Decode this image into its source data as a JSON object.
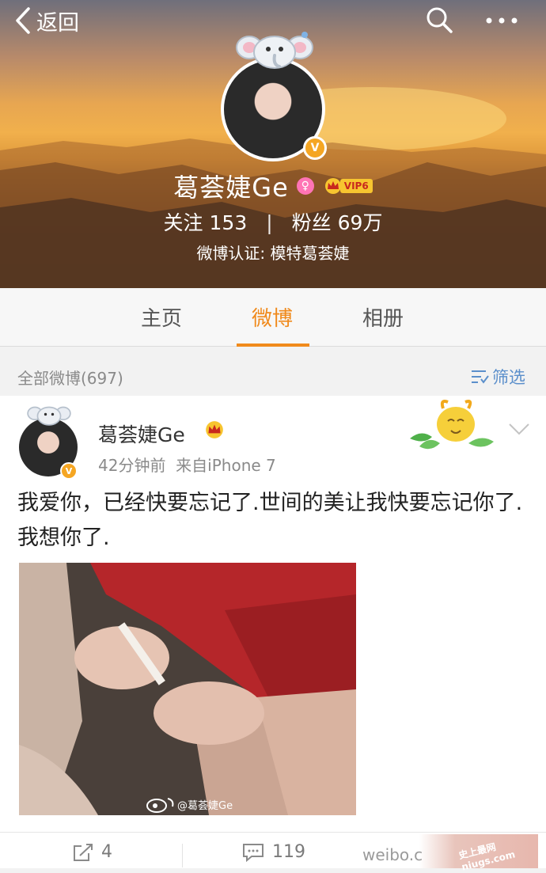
{
  "header": {
    "back_label": "返回",
    "user_name": "葛荟婕Ge",
    "female_icon": "female-icon",
    "vip_badge": "VIP6",
    "following_label": "关注",
    "following_count": "153",
    "separator": "|",
    "followers_label": "粉丝",
    "followers_count": "69万",
    "verification": "微博认证: 模特葛荟婕"
  },
  "tabs": [
    {
      "label": "主页",
      "active": false
    },
    {
      "label": "微博",
      "active": true
    },
    {
      "label": "相册",
      "active": false
    }
  ],
  "filter_bar": {
    "count_label": "全部微博(697)",
    "filter_label": "筛选"
  },
  "post": {
    "author": "葛荟婕Ge",
    "time": "42分钟前",
    "source": "来自iPhone 7",
    "text": "我爱你，已经快要忘记了.世间的美让我快要忘记你了.我想你了.",
    "image_watermark": "@葛荟婕Ge",
    "repost_count": "4",
    "comment_count": "119"
  },
  "watermark": {
    "site_text": "weibo.c",
    "logo_text": "史上最网 niugs.com"
  },
  "colors": {
    "accent": "#f08a1c",
    "link": "#5b8fcb",
    "verify": "#f5a623"
  }
}
